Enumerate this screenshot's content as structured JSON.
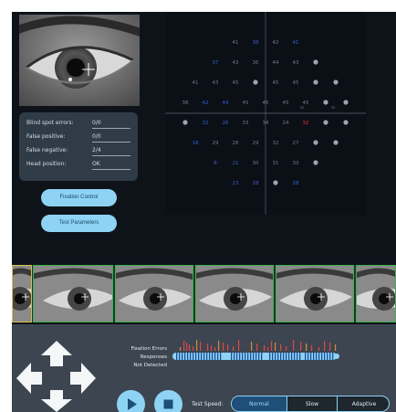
{
  "stats": {
    "blind_spot": {
      "label": "Blind spot errors:",
      "value": "0/0"
    },
    "false_positive": {
      "label": "False positive:",
      "value": "0/0"
    },
    "false_negative": {
      "label": "False negative:",
      "value": "2/4"
    },
    "head_position": {
      "label": "Head position:",
      "value": "OK"
    }
  },
  "buttons": {
    "fixation_control": "Fixation Control",
    "test_parameters": "Test Parameters"
  },
  "field": {
    "rows": [
      [
        {
          "t": "41",
          "c": "g"
        },
        {
          "t": "38",
          "c": "b"
        },
        {
          "t": "42",
          "c": "g"
        },
        {
          "t": "41",
          "c": "b"
        }
      ],
      [
        {
          "t": "37",
          "c": "b"
        },
        {
          "t": "43",
          "c": "g"
        },
        {
          "t": "36",
          "c": "g"
        },
        {
          "t": "44",
          "c": "g"
        },
        {
          "t": "43",
          "c": "g"
        },
        {
          "t": "",
          "c": "dot"
        }
      ],
      [
        {
          "t": "41",
          "c": "g"
        },
        {
          "t": "43",
          "c": "g"
        },
        {
          "t": "45",
          "c": "g"
        },
        {
          "t": "",
          "c": "dot"
        },
        {
          "t": "45",
          "c": "g"
        },
        {
          "t": "45",
          "c": "g"
        },
        {
          "t": "",
          "c": "dot"
        },
        {
          "t": "",
          "c": "dot"
        }
      ],
      [
        {
          "t": "38",
          "c": "g"
        },
        {
          "t": "42",
          "c": "b"
        },
        {
          "t": "44",
          "c": "b"
        },
        {
          "t": "45",
          "c": "g"
        },
        {
          "t": "45",
          "c": "g"
        },
        {
          "t": "45",
          "c": "g"
        },
        {
          "t": "45",
          "c": "g"
        },
        {
          "t": "",
          "c": "dot"
        },
        {
          "t": "",
          "c": "dot"
        }
      ],
      [
        {
          "t": "",
          "c": "dot"
        },
        {
          "t": "32",
          "c": "b"
        },
        {
          "t": "26",
          "c": "b"
        },
        {
          "t": "33",
          "c": "g"
        },
        {
          "t": "34",
          "c": "g"
        },
        {
          "t": "24",
          "c": "g"
        },
        {
          "t": "32",
          "c": "r"
        },
        {
          "t": "",
          "c": "dot"
        },
        {
          "t": "",
          "c": "dot"
        }
      ],
      [
        {
          "t": "18",
          "c": "b"
        },
        {
          "t": "29",
          "c": "g"
        },
        {
          "t": "28",
          "c": "g"
        },
        {
          "t": "29",
          "c": "g"
        },
        {
          "t": "32",
          "c": "g"
        },
        {
          "t": "27",
          "c": "g"
        },
        {
          "t": "",
          "c": "dot"
        },
        {
          "t": "",
          "c": "dot"
        }
      ],
      [
        {
          "t": "8",
          "c": "b"
        },
        {
          "t": "21",
          "c": "b"
        },
        {
          "t": "30",
          "c": "g"
        },
        {
          "t": "31",
          "c": "g"
        },
        {
          "t": "33",
          "c": "g"
        },
        {
          "t": "",
          "c": "dot"
        }
      ],
      [
        {
          "t": "23",
          "c": "b"
        },
        {
          "t": "28",
          "c": "b"
        },
        {
          "t": "",
          "c": "dot"
        },
        {
          "t": "28",
          "c": "b"
        }
      ]
    ],
    "small_marks": [
      "30",
      "30"
    ]
  },
  "bottom": {
    "fixation_errors": "Fixation Errors",
    "responses": "Responses",
    "not_detected": "Not Detected",
    "test_speed_label": "Test Speed:",
    "speeds": [
      "Normal",
      "Slow",
      "Adaptive"
    ],
    "selected_speed": "Normal"
  },
  "colors": {
    "accent": "#8fd3f4",
    "value_gray": "#6f7a86",
    "value_blue": "#3b5bd6",
    "value_red": "#e23b3b",
    "frame_green": "#3bb34a",
    "frame_yellow": "#d8c24a"
  },
  "icons": [
    "up-arrow-icon",
    "left-arrow-icon",
    "right-arrow-icon",
    "down-arrow-icon",
    "play-icon",
    "stop-icon",
    "crosshair-icon"
  ]
}
